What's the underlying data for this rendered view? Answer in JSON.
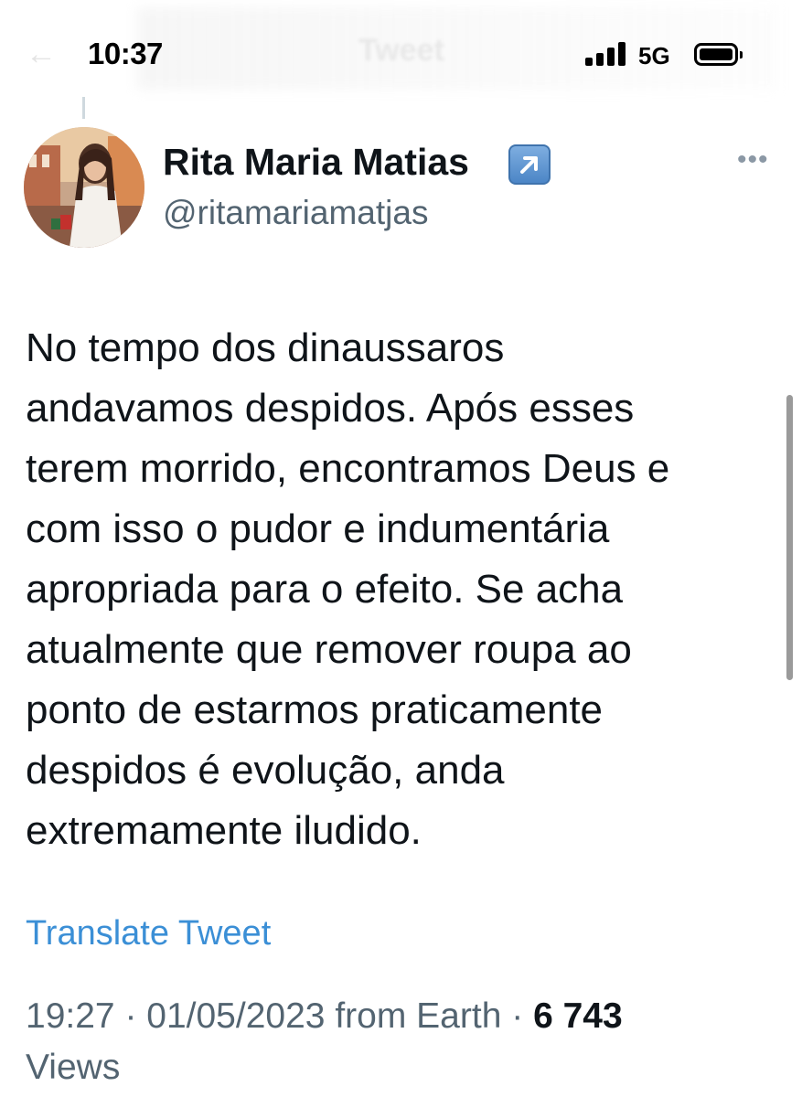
{
  "status_bar": {
    "time": "10:37",
    "network": "5G",
    "header_back_glyph": "←",
    "header_title": "Tweet"
  },
  "tweet": {
    "display_name": "Rita Maria Matias",
    "badge_icon": "arrow-up-right-icon",
    "handle": "@ritamariamatjas",
    "more_icon": "more-options-icon",
    "more_glyph": "•••",
    "text_lines": [
      "No tempo dos dinaussaros",
      "andavamos despidos. Após esses",
      "terem morrido, encontramos Deus e",
      "com isso o pudor e indumentária",
      "apropriada para o efeito. Se acha",
      "atualmente que remover roupa ao",
      "ponto de estarmos praticamente",
      "despidos é evolução, anda",
      "extremamente iludido."
    ],
    "translate_label": "Translate Tweet",
    "time": "19:27",
    "separator": " · ",
    "date": "01/05/2023",
    "source": "from Earth",
    "views_count": "6 743",
    "views_label": "Views"
  },
  "colors": {
    "text": "#0f1419",
    "secondary": "#536471",
    "link": "#3b8fd6"
  }
}
